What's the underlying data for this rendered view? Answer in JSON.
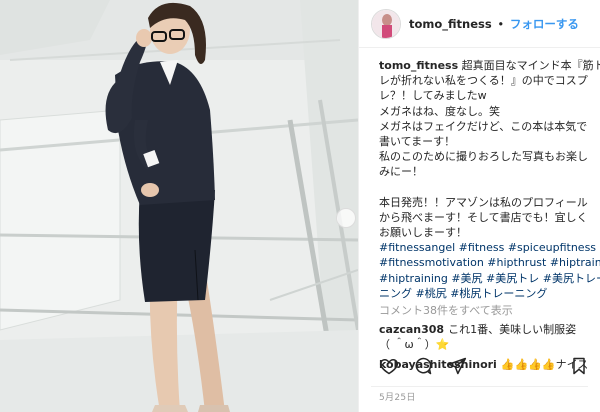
{
  "post": {
    "username": "tomo_fitness",
    "separator": "•",
    "follow_label": "フォローする"
  },
  "caption": {
    "user": "tomo_fitness",
    "lines": [
      " 超真面目なマインド本『筋ト",
      "レが折れない私をつくる！』の中でコスプ",
      "レ？！してみましたw",
      "メガネはね、度なし。笑",
      "メガネはフェイクだけど、この本は本気で",
      "書いてまーす！",
      "私のこのために撮りおろした写真もお楽し",
      "みにー！",
      "本日発売！！アマゾンは私のプロフィール",
      "から飛べまーす！そして書店でも！宜しく",
      "お願いしまーす！"
    ],
    "hashtags": [
      "#fitnessangel #fitness #spiceupfitness",
      "#fitnessmotivation #hipthrust #hiptraing",
      "#hiptraining #美尻 #美尻トレ #美尻トレー",
      "ニング #桃尻 #桃尻トレーニング"
    ]
  },
  "view_all_comments": "コメント38件をすべて表示",
  "comments": [
    {
      "user": "cazcan308",
      "text": "これ1番、美味しい制服姿",
      "text2": "（ ＾ω＾）⭐"
    },
    {
      "user": "kobayashitoshinori",
      "text": "👍👍👍👍ナイス"
    }
  ],
  "date": "5月25日",
  "icons": [
    "heart-icon",
    "comment-icon",
    "share-icon",
    "bookmark-icon"
  ],
  "colors": {
    "link_blue": "#3897f0",
    "hashtag": "#003569",
    "muted": "#999999",
    "border": "#efefef"
  }
}
